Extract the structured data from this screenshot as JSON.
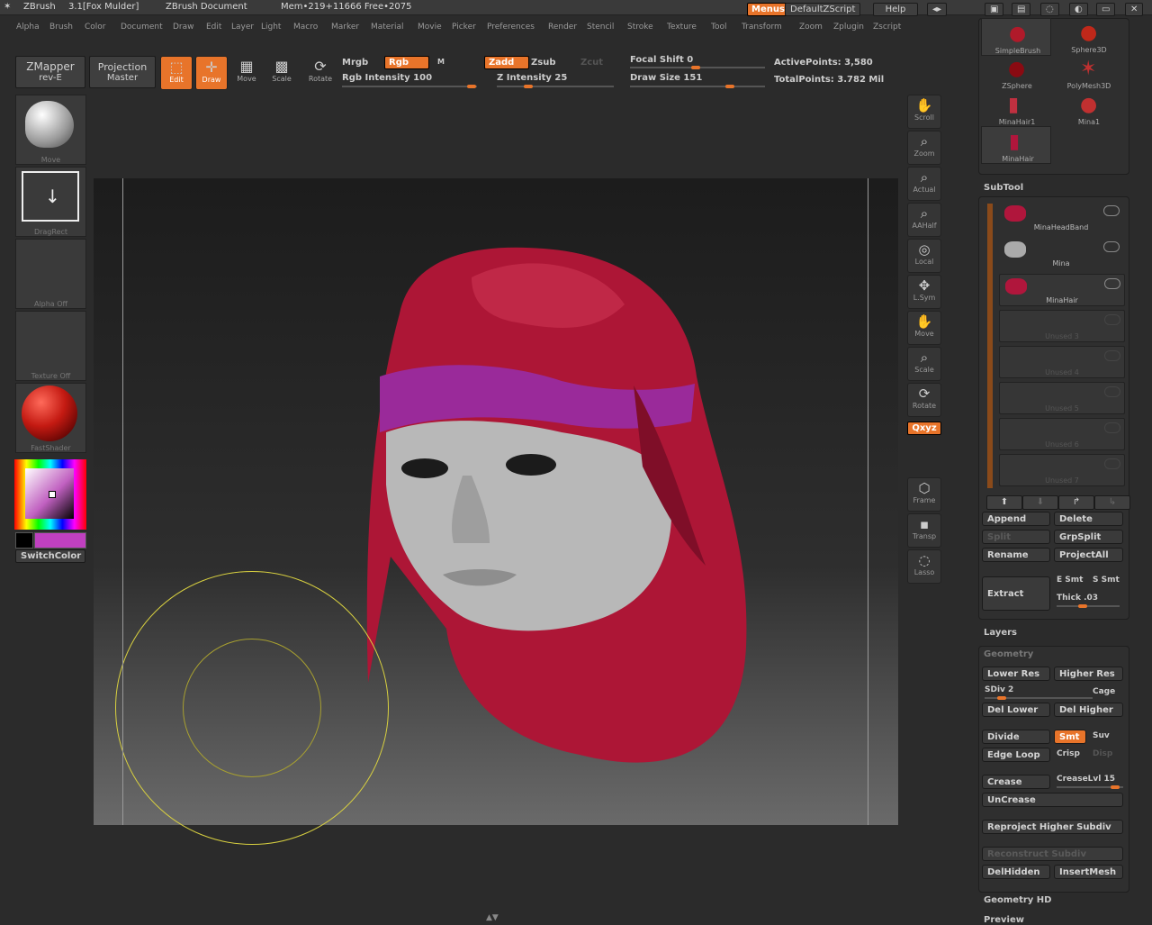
{
  "titlebar": {
    "app": "ZBrush",
    "version": "3.1[Fox Mulder]",
    "document": "ZBrush Document",
    "mem": "Mem•219+11666 Free•2075",
    "menus_btn": "Menus",
    "script_btn": "DefaultZScript",
    "help_btn": "Help"
  },
  "menubar": [
    "Alpha",
    "Brush",
    "Color",
    "Document",
    "Draw",
    "Edit",
    "Layer",
    "Light",
    "Macro",
    "Marker",
    "Material",
    "Movie",
    "Picker",
    "Preferences",
    "Render",
    "Stencil",
    "Stroke",
    "Texture",
    "Tool",
    "Transform",
    "Zoom",
    "Zplugin",
    "Zscript"
  ],
  "shelf": {
    "zmapper": "ZMapper",
    "zmapper_sub": "rev-E",
    "projection": "Projection",
    "projection_sub": "Master",
    "edit": "Edit",
    "draw": "Draw",
    "move": "Move",
    "scale": "Scale",
    "rotate": "Rotate",
    "mrgb": "Mrgb",
    "rgb": "Rgb",
    "m": "M",
    "rgb_intensity": "Rgb Intensity 100",
    "rgb_intensity_value": 100,
    "zadd": "Zadd",
    "zsub": "Zsub",
    "zcut": "Zcut",
    "z_intensity": "Z Intensity 25",
    "z_intensity_value": 25,
    "focal_shift": "Focal Shift 0",
    "focal_shift_value": 0,
    "draw_size": "Draw Size 151",
    "draw_size_value": 151,
    "active_points": "ActivePoints: 3,580",
    "total_points": "TotalPoints: 3.782 Mil"
  },
  "leftshelf": {
    "move": "Move",
    "dragrect": "DragRect",
    "alpha": "Alpha Off",
    "texture": "Texture Off",
    "fastshader": "FastShader",
    "switchcolor": "SwitchColor"
  },
  "rightshelf": [
    "Scroll",
    "Zoom",
    "Actual",
    "AAHalf",
    "Local",
    "L.Sym",
    "Move",
    "Scale",
    "Rotate",
    "Frame",
    "Transp",
    "Lasso"
  ],
  "rightshelf_xyz": "Qxyz",
  "tools": {
    "items": [
      "SimpleBrush",
      "Sphere3D",
      "ZSphere",
      "PolyMesh3D",
      "MinaHair1",
      "Mina1",
      "MinaHair",
      "MinaHair"
    ]
  },
  "subtool": {
    "title": "SubTool",
    "items": [
      {
        "name": "MinaHeadBand"
      },
      {
        "name": "Mina"
      },
      {
        "name": "MinaHair"
      },
      {
        "name": "Unused 3"
      },
      {
        "name": "Unused 4"
      },
      {
        "name": "Unused 5"
      },
      {
        "name": "Unused 6"
      },
      {
        "name": "Unused 7"
      }
    ],
    "append": "Append",
    "delete": "Delete",
    "split": "Split",
    "grpsplit": "GrpSplit",
    "rename": "Rename",
    "projectall": "ProjectAll",
    "extract": "Extract",
    "esmt": "E Smt",
    "ssmt": "S Smt",
    "thick": "Thick .03"
  },
  "layers": {
    "title": "Layers"
  },
  "geometry": {
    "title": "Geometry",
    "lower_res": "Lower Res",
    "higher_res": "Higher Res",
    "sdiv": "SDiv 2",
    "sdiv_value": 2,
    "cage": "Cage",
    "del_lower": "Del Lower",
    "del_higher": "Del Higher",
    "divide": "Divide",
    "smt": "Smt",
    "suv": "Suv",
    "edge_loop": "Edge Loop",
    "crisp": "Crisp",
    "disp": "Disp",
    "crease": "Crease",
    "creaselvl": "CreaseLvl 15",
    "uncrease": "UnCrease",
    "reproject": "Reproject Higher Subdiv",
    "reconstruct": "Reconstruct Subdiv",
    "delhidden": "DelHidden",
    "insertmesh": "InsertMesh"
  },
  "geometry_hd": {
    "title": "Geometry HD"
  },
  "preview": {
    "title": "Preview"
  },
  "colors": {
    "accent": "#e8742a",
    "hood": "#b0163c",
    "band": "#9a2a9a",
    "face": "#bcbcbc",
    "brush_ring": "#d8d040"
  }
}
